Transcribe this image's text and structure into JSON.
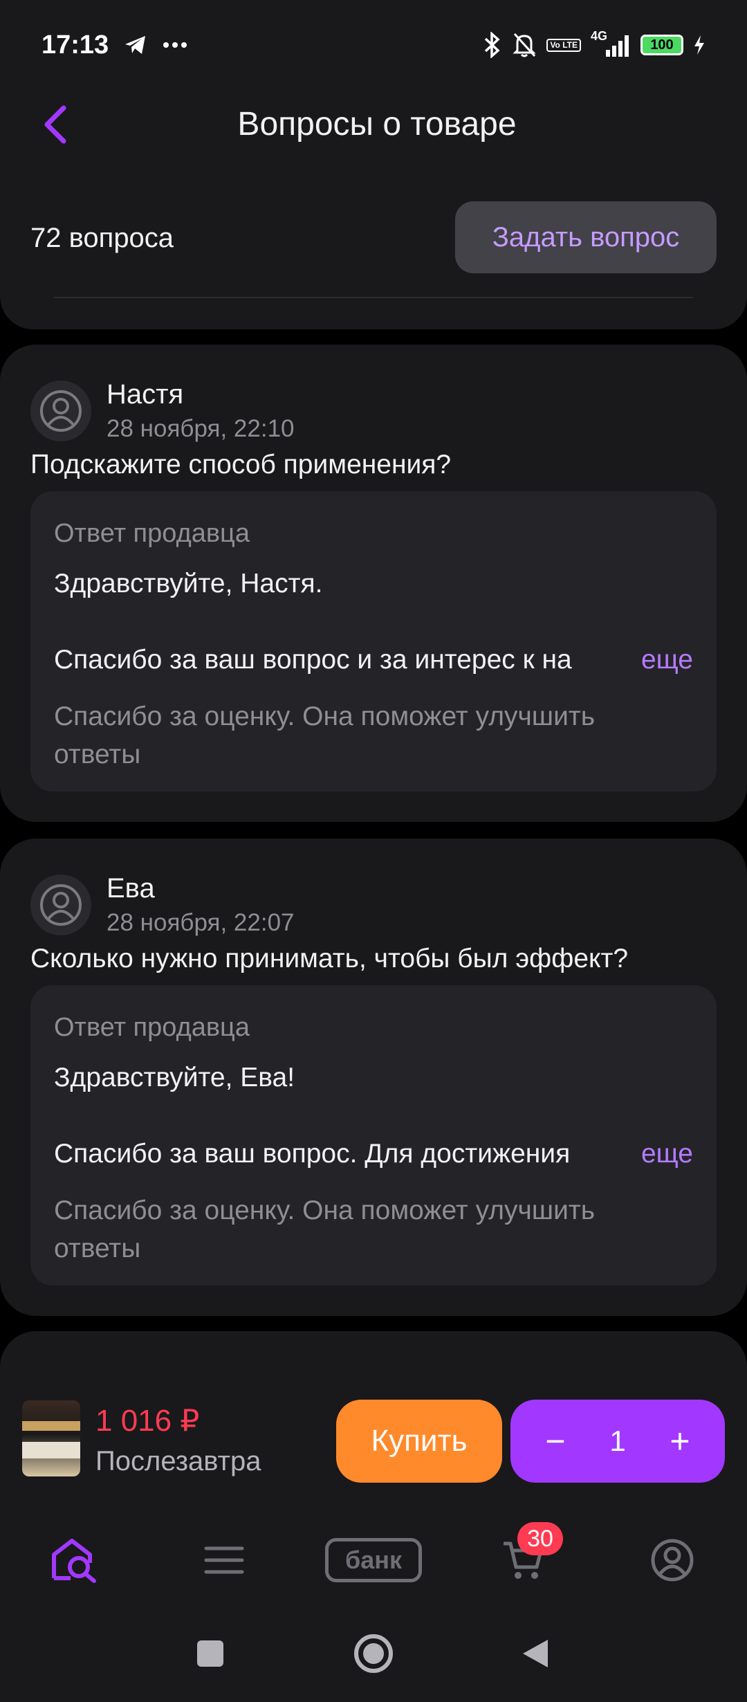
{
  "status_bar": {
    "time": "17:13",
    "network": "4G",
    "volte": "Vo LTE",
    "battery": "100"
  },
  "header": {
    "title": "Вопросы о товаре",
    "question_count": "72 вопроса",
    "ask_button": "Задать вопрос"
  },
  "questions": [
    {
      "author": "Настя",
      "date": "28 ноября, 22:10",
      "text": "Подскажите способ применения?",
      "answer": {
        "title": "Ответ продавца",
        "greeting": "Здравствуйте, Настя.",
        "preview": "Спасибо за ваш вопрос и за интерес к на",
        "more": "еще",
        "rating_prompt": "Спасибо за оценку. Она поможет улучшить ответы"
      }
    },
    {
      "author": "Ева",
      "date": "28 ноября, 22:07",
      "text": "Сколько нужно принимать, чтобы был эффект?",
      "answer": {
        "title": "Ответ продавца",
        "greeting": "Здравствуйте, Ева!",
        "preview": "Спасибо за ваш вопрос. Для достижения",
        "more": "еще",
        "rating_prompt": "Спасибо за оценку. Она поможет улучшить ответы"
      }
    }
  ],
  "buy_bar": {
    "price": "1 016 ₽",
    "delivery": "Послезавтра",
    "buy_button": "Купить",
    "quantity": "1",
    "minus": "−",
    "plus": "+"
  },
  "bottom_nav": {
    "items": [
      "home-search-icon",
      "catalog-menu-icon",
      "bank-icon",
      "cart-icon",
      "profile-icon"
    ],
    "bank_label": "банк",
    "cart_badge": "30",
    "active_color": "#a238ff"
  },
  "colors": {
    "accent": "#a238ff",
    "price": "#ff3b52",
    "buy": "#ff8a2c",
    "link": "#b57bff"
  }
}
